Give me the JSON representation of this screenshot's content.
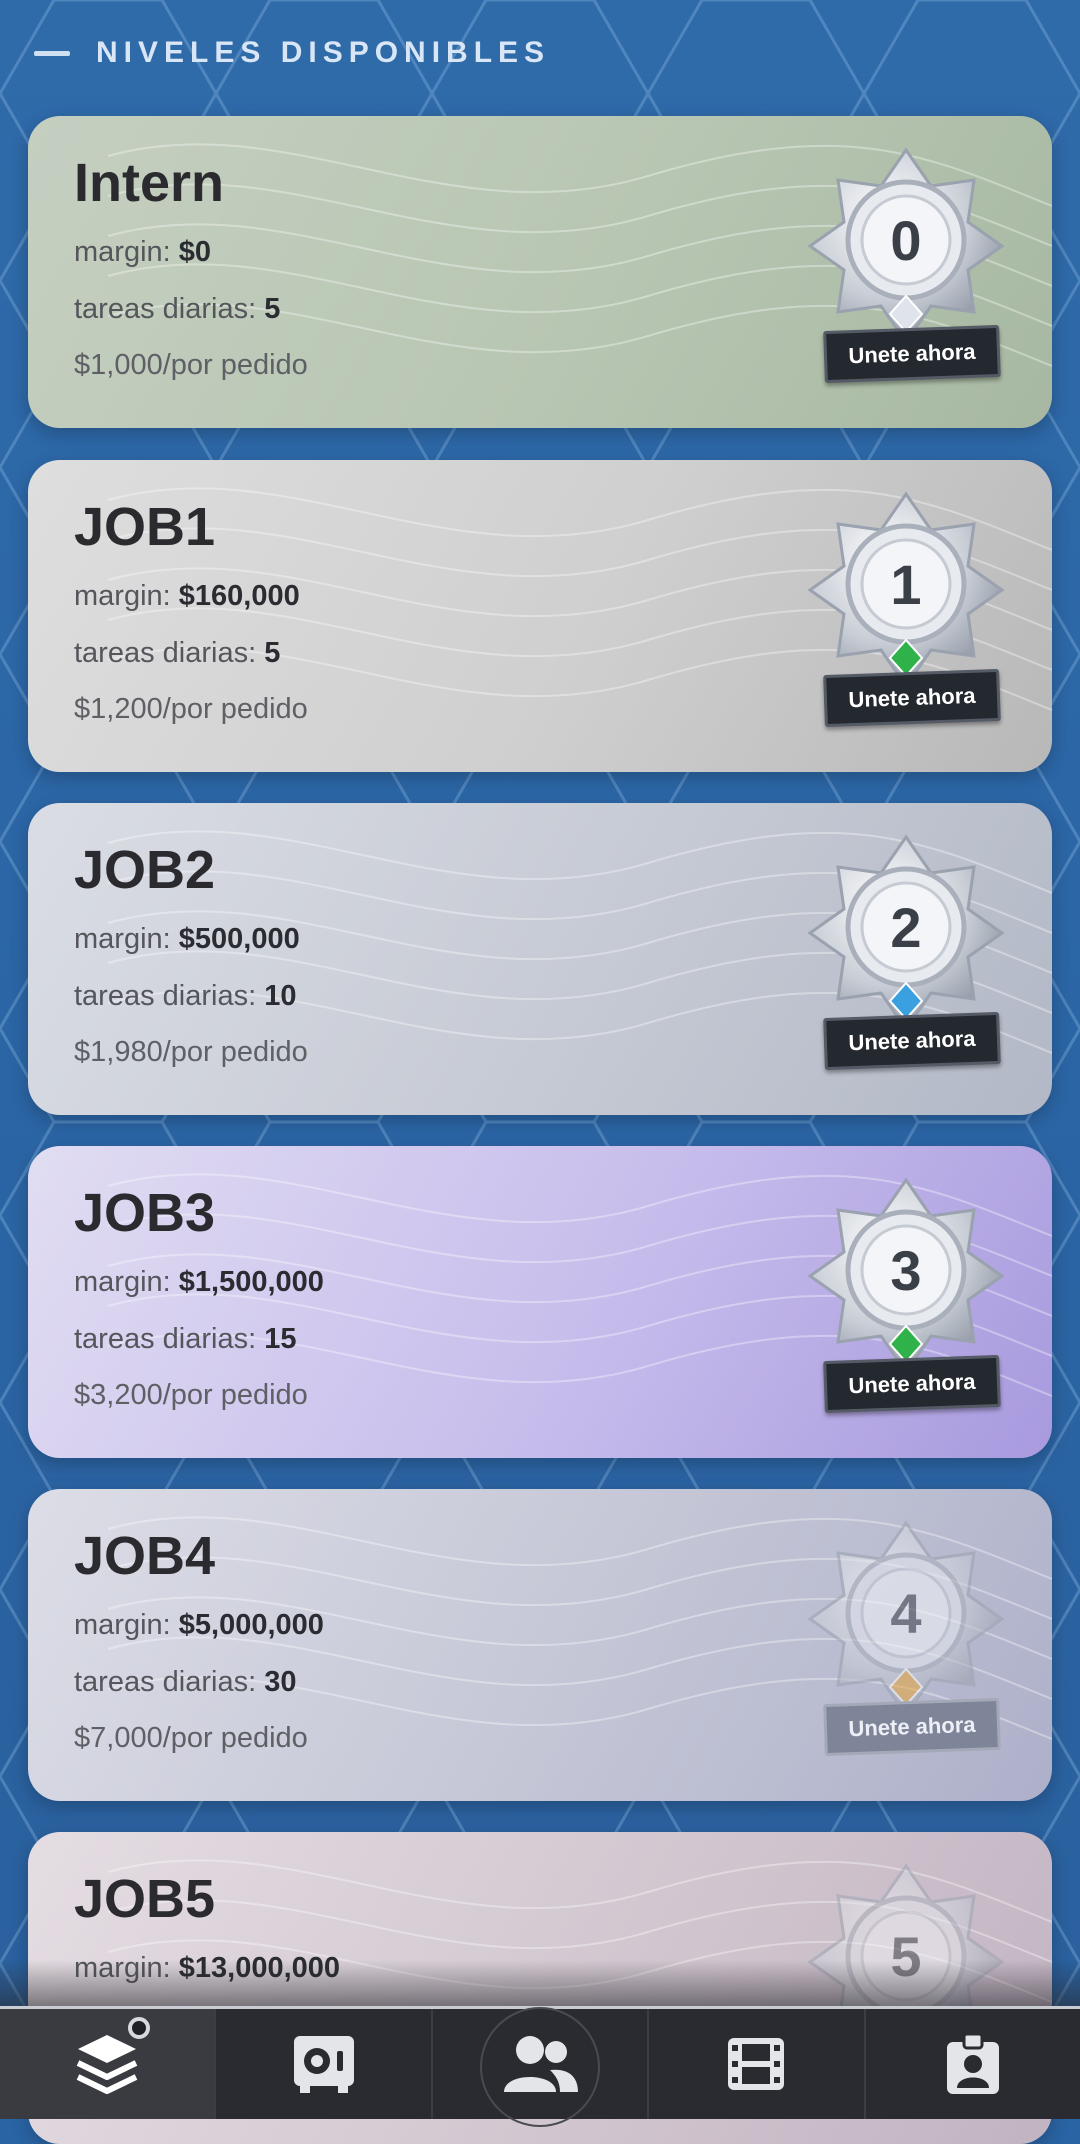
{
  "section": {
    "title": "NIVELES DISPONIBLES"
  },
  "levels": [
    {
      "name": "Intern",
      "margin_label": "margin:",
      "margin": "$0",
      "tasks_label": "tareas diarias:",
      "tasks": "5",
      "price": "$1,000/por pedido",
      "badge_number": "0",
      "button": "Unete ahora",
      "gem_color": "#dfe4ec"
    },
    {
      "name": "JOB1",
      "margin_label": "margin:",
      "margin": "$160,000",
      "tasks_label": "tareas diarias:",
      "tasks": "5",
      "price": "$1,200/por pedido",
      "badge_number": "1",
      "button": "Unete ahora",
      "gem_color": "#2fb24a"
    },
    {
      "name": "JOB2",
      "margin_label": "margin:",
      "margin": "$500,000",
      "tasks_label": "tareas diarias:",
      "tasks": "10",
      "price": "$1,980/por pedido",
      "badge_number": "2",
      "button": "Unete ahora",
      "gem_color": "#3aa0e0"
    },
    {
      "name": "JOB3",
      "margin_label": "margin:",
      "margin": "$1,500,000",
      "tasks_label": "tareas diarias:",
      "tasks": "15",
      "price": "$3,200/por pedido",
      "badge_number": "3",
      "button": "Unete ahora",
      "gem_color": "#2fb24a"
    },
    {
      "name": "JOB4",
      "margin_label": "margin:",
      "margin": "$5,000,000",
      "tasks_label": "tareas diarias:",
      "tasks": "30",
      "price": "$7,000/por pedido",
      "badge_number": "4",
      "button": "Unete ahora",
      "gem_color": "#e8a53a"
    },
    {
      "name": "JOB5",
      "margin_label": "margin:",
      "margin": "$13,000,000",
      "tasks_label": "",
      "tasks": "",
      "price": "",
      "badge_number": "5",
      "button": "",
      "gem_color": "#e07a3a"
    }
  ],
  "nav": {
    "items": [
      {
        "icon": "layers-icon",
        "active": true
      },
      {
        "icon": "safe-icon",
        "active": false
      },
      {
        "icon": "team-icon",
        "active": false
      },
      {
        "icon": "film-icon",
        "active": false
      },
      {
        "icon": "profile-badge-icon",
        "active": false
      }
    ]
  }
}
